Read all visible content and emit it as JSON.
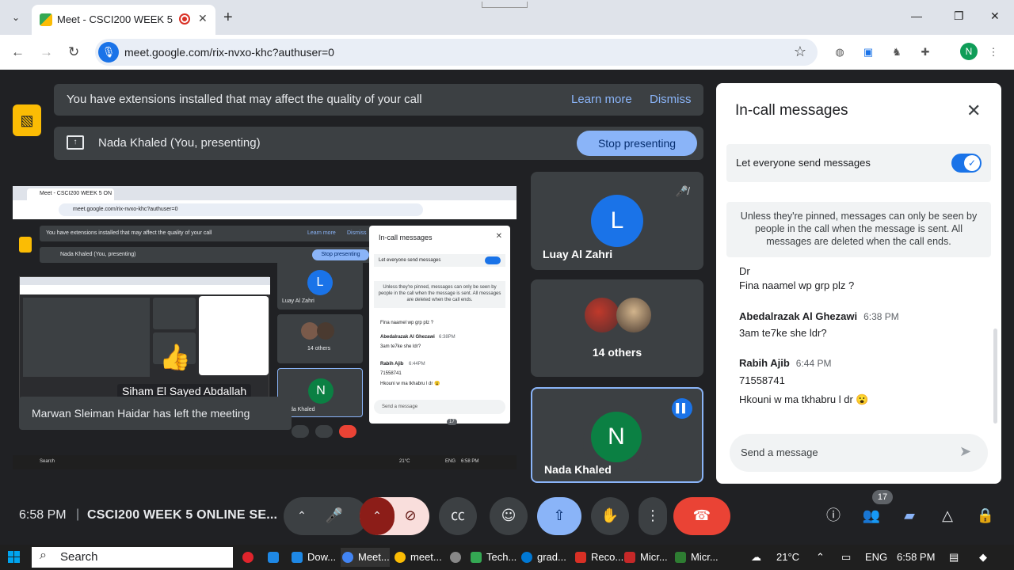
{
  "browser": {
    "tab_title": "Meet - CSCI200 WEEK 5 ON",
    "url": "meet.google.com/rix-nvxo-khc?authuser=0",
    "profile_initial": "N"
  },
  "banner": {
    "message": "You have extensions installed that may affect the quality of your call",
    "learn_more": "Learn more",
    "dismiss": "Dismiss"
  },
  "presenting": {
    "label": "Nada Khaled (You, presenting)",
    "stop_button": "Stop presenting"
  },
  "presentation": {
    "tab_title": "Meet - CSCI200 WEEK 5 ON",
    "url": "meet.google.com/rix-nvxo-khc?authuser=0",
    "banner": "You have extensions installed that may affect the quality of your call",
    "learn_more": "Learn more",
    "dismiss": "Dismiss",
    "presenting": "Nada Khaled (You, presenting)",
    "stop": "Stop presenting",
    "participant_1": "Luay Al Zahri",
    "others": "14 others",
    "self_name": "Nada Khaled",
    "panel_title": "In-call messages",
    "let_everyone": "Let everyone send messages",
    "info": "Unless they're pinned, messages can only be seen by people in the call when the message is sent. All messages are deleted when the call ends.",
    "line_a": "Fina naamel wp grp plz ?",
    "sender_b": "Abedalrazak Al Ghezawi",
    "time_b": "6:38PM",
    "line_b": "3am te7ke she ldr?",
    "sender_c": "Rabih Ajib",
    "time_c": "6:44PM",
    "line_c": "71558741",
    "line_d": "Hkouni w ma tkhabru l dr 😮",
    "send_placeholder": "Send a message",
    "toast": "Marwan Sleiman Haidar has left the meeting",
    "speaker_label": "Siham El Sayed Abdallah",
    "taskbar_search": "Search",
    "badge": "17",
    "weather": "21°C",
    "lang": "ENG",
    "time": "6:58 PM"
  },
  "tiles": {
    "luay": {
      "initial": "L",
      "name": "Luay Al Zahri"
    },
    "others": {
      "label": "14 others"
    },
    "self": {
      "initial": "N",
      "name": "Nada Khaled"
    }
  },
  "chat": {
    "title": "In-call messages",
    "setting_label": "Let everyone send messages",
    "info": "Unless they're pinned, messages can only be seen by people in the call when the message is sent. All messages are deleted when the call ends.",
    "partial_line": "Dr",
    "messages": [
      {
        "text": "Fina naamel wp grp plz ?"
      },
      {
        "sender": "Abedalrazak Al Ghezawi",
        "time": "6:38 PM",
        "text": "3am te7ke she ldr?"
      },
      {
        "sender": "Rabih Ajib",
        "time": "6:44 PM",
        "text": "71558741",
        "text2": "Hkouni w ma tkhabru l dr 😮"
      }
    ],
    "send_placeholder": "Send a message"
  },
  "controls": {
    "time": "6:58 PM",
    "separator": "|",
    "meeting_name": "CSCI200 WEEK 5 ONLINE SE...",
    "people_count": "17"
  },
  "taskbar": {
    "search": "Search",
    "apps": [
      "Dow...",
      "Meet...",
      "meet...",
      "Tech...",
      "grad...",
      "Reco...",
      "Micr...",
      "Micr..."
    ],
    "weather": "21°C",
    "language": "ENG",
    "time": "6:58 PM"
  },
  "colors": {
    "meet_bg": "#202124",
    "surface": "#3c4043",
    "accent": "#8ab4f8",
    "blue": "#1a73e8",
    "hangup": "#ea4335",
    "camera_off": "#f9dedc"
  }
}
